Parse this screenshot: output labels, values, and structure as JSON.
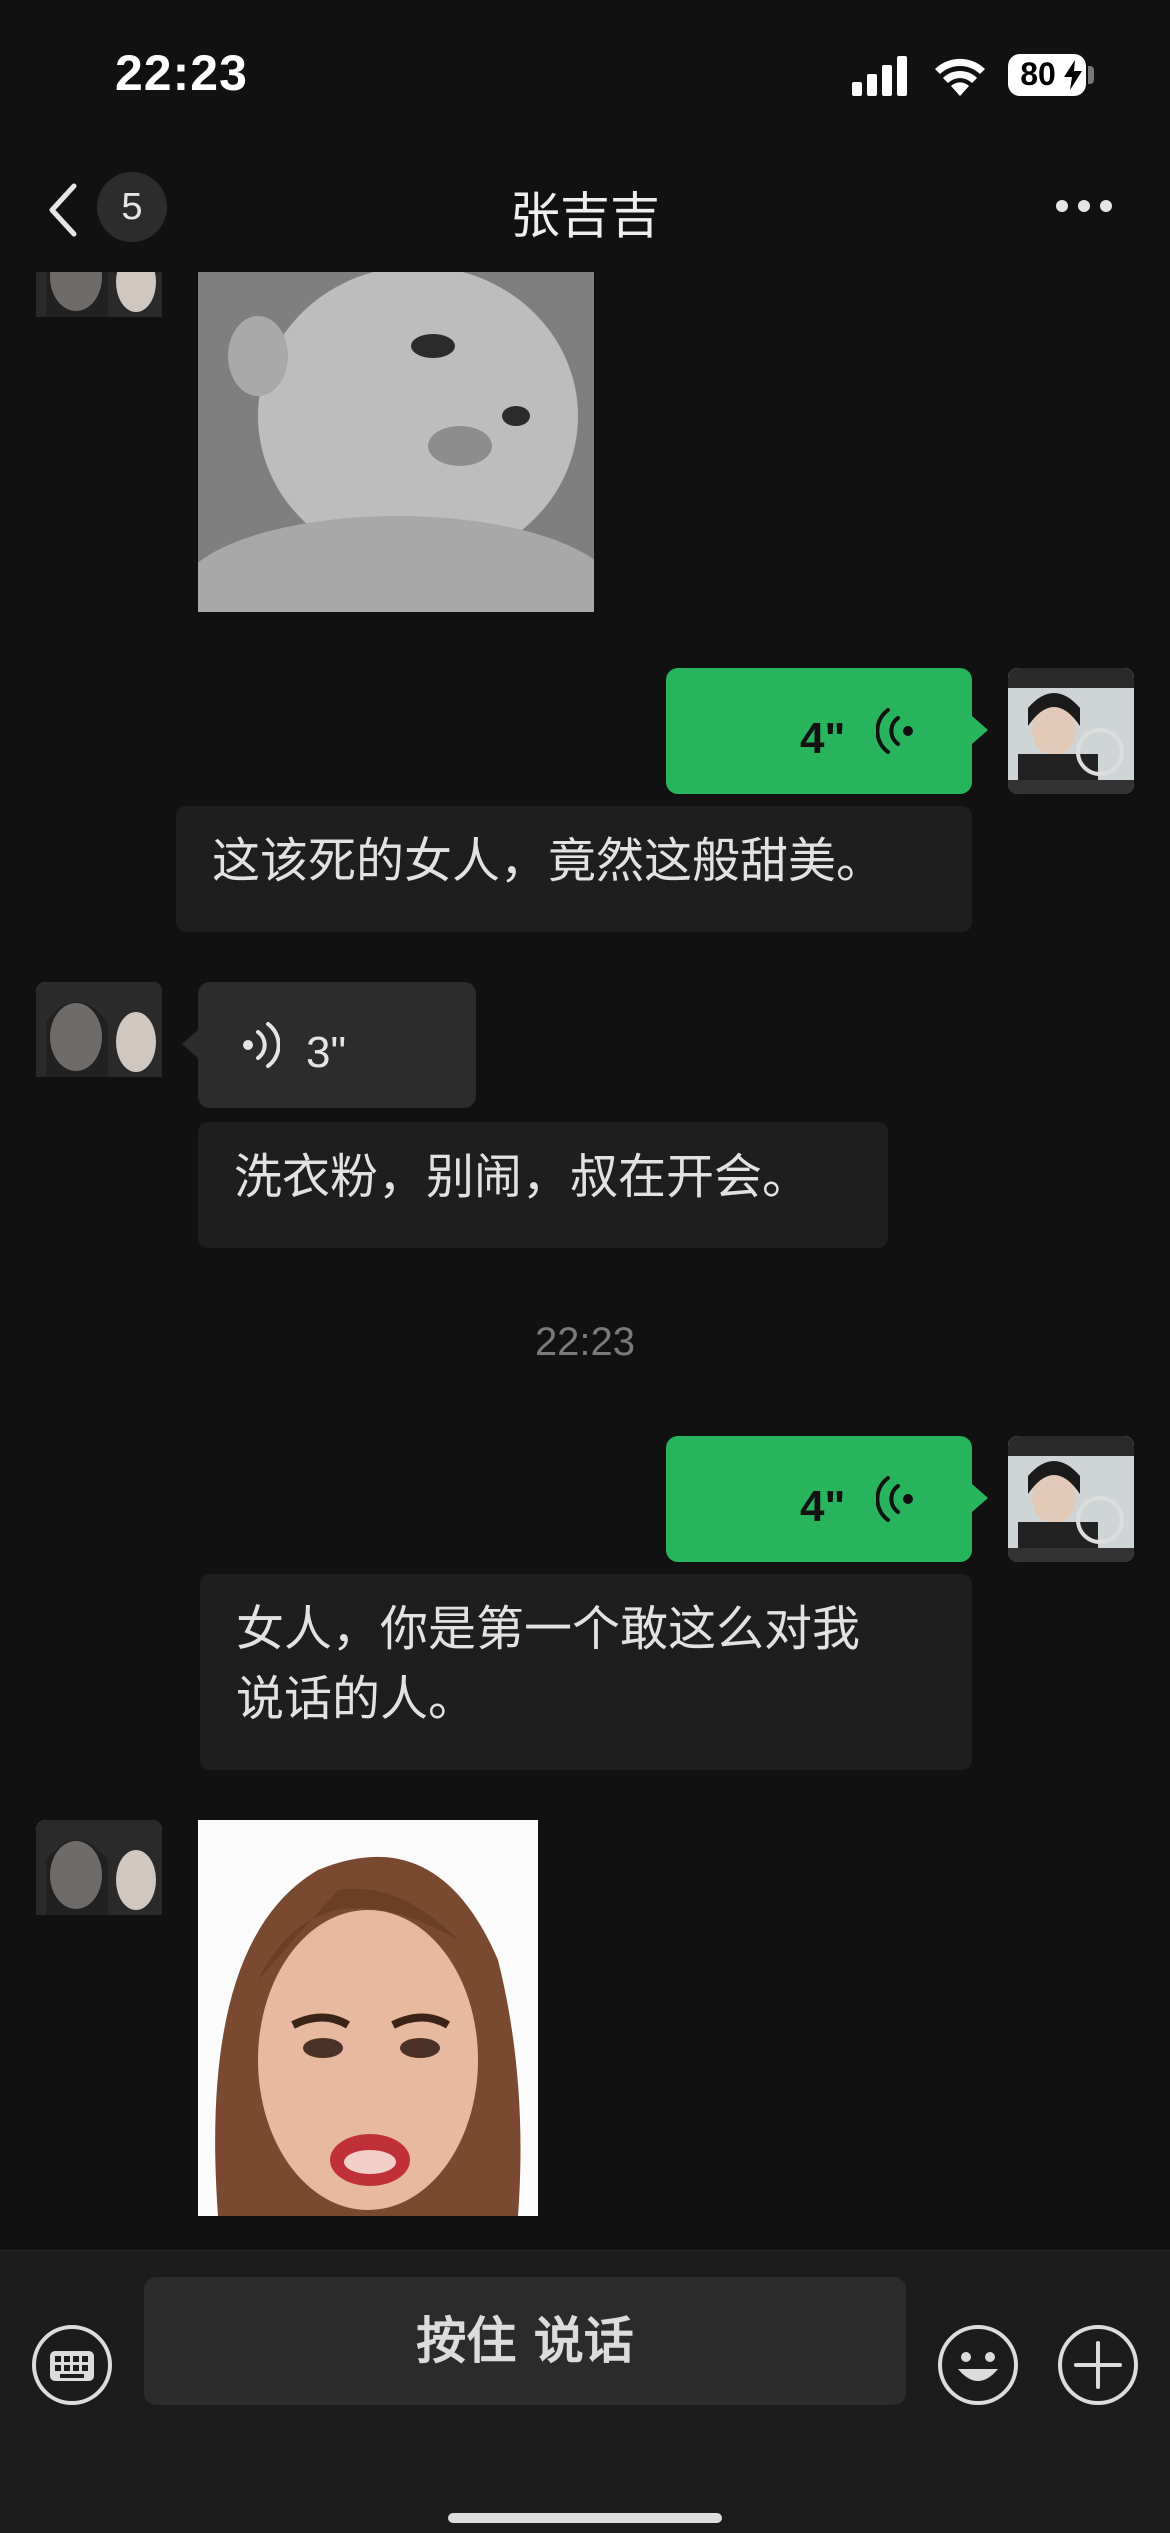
{
  "status_bar": {
    "time": "22:23",
    "battery": "80",
    "icons": [
      "cellular-signal-icon",
      "wifi-icon",
      "battery-charging-icon"
    ]
  },
  "nav": {
    "back_icon": "chevron-left-icon",
    "unread_count": "5",
    "title": "张吉吉",
    "more_icon": "more-horizontal-icon"
  },
  "messages": [
    {
      "type": "sticker",
      "sender": "contact",
      "description_icon": "baby-face-sticker"
    },
    {
      "type": "voice",
      "sender": "me",
      "duration": "4\"",
      "transcript": "这该死的女人，竟然这般甜美。"
    },
    {
      "type": "voice",
      "sender": "contact",
      "duration": "3\"",
      "transcript": "洗衣粉，别闹，叔在开会。"
    },
    {
      "type": "timestamp",
      "text": "22:23"
    },
    {
      "type": "voice",
      "sender": "me",
      "duration": "4\"",
      "transcript_line1": "女人，你是第一个敢这么对我",
      "transcript_line2": "说话的人。"
    },
    {
      "type": "sticker",
      "sender": "contact",
      "description_icon": "woman-face-sticker"
    }
  ],
  "input_bar": {
    "hold_to_talk_label": "按住 说话",
    "icons": [
      "keyboard-icon",
      "emoji-icon",
      "plus-icon"
    ]
  },
  "colors": {
    "background": "#111111",
    "my_bubble": "#27b45d",
    "contact_bubble": "#2c2c2c",
    "transcript_bg": "#1e1e1e"
  }
}
